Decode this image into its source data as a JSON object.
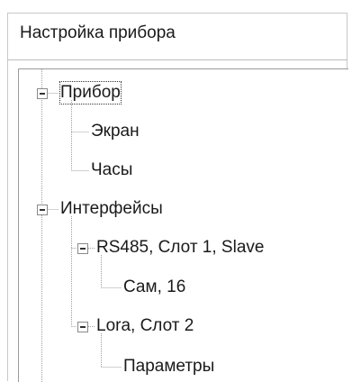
{
  "panel": {
    "title": "Настройка прибора"
  },
  "tree": {
    "nodes": [
      {
        "label": "Прибор",
        "expanded": true,
        "selected": true
      },
      {
        "label": "Экран"
      },
      {
        "label": "Часы"
      },
      {
        "label": "Интерфейсы",
        "expanded": true
      },
      {
        "label": "RS485, Слот 1, Slave",
        "expanded": true
      },
      {
        "label": "Сам, 16"
      },
      {
        "label": "Lora, Слот 2",
        "expanded": true
      },
      {
        "label": "Параметры"
      }
    ]
  }
}
